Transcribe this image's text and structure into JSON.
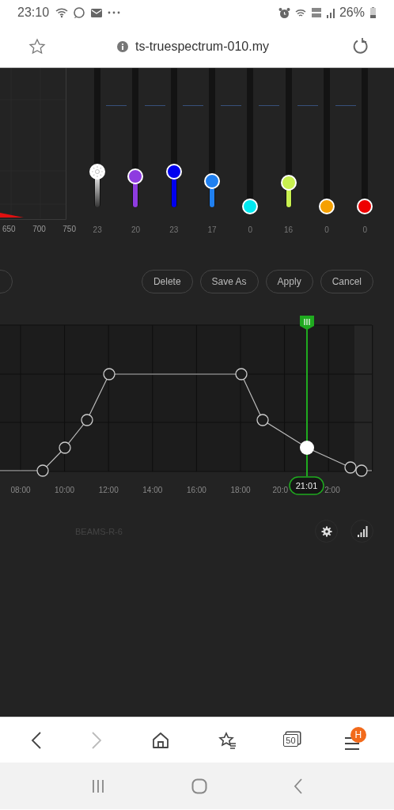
{
  "status_bar": {
    "time": "23:10",
    "battery": "26%"
  },
  "address_bar": {
    "url": "ts-truespectrum-010.my"
  },
  "spectrum": {
    "axis_labels": [
      "650",
      "700",
      "750"
    ]
  },
  "channels": [
    {
      "kind": "white",
      "color": "#ffffff",
      "level": 0.23,
      "reading": "23"
    },
    {
      "kind": "color",
      "color": "#8e3ce0",
      "level": 0.2,
      "reading": "20"
    },
    {
      "kind": "color",
      "color": "#0000ee",
      "level": 0.23,
      "reading": "23"
    },
    {
      "kind": "color",
      "color": "#2080f0",
      "level": 0.17,
      "reading": "17"
    },
    {
      "kind": "color",
      "color": "#00e8f0",
      "level": 0,
      "reading": "0"
    },
    {
      "kind": "color",
      "color": "#c8f050",
      "level": 0.16,
      "reading": "16"
    },
    {
      "kind": "color",
      "color": "#f5a000",
      "level": 0,
      "reading": "0"
    },
    {
      "kind": "color",
      "color": "#ee0000",
      "level": 0,
      "reading": "0"
    }
  ],
  "actions": [
    {
      "kind": "clipped"
    },
    {
      "kind": "button",
      "label": "Delete"
    },
    {
      "kind": "button",
      "label": "Save As"
    },
    {
      "kind": "button",
      "label": "Apply"
    },
    {
      "kind": "button",
      "label": "Cancel"
    }
  ],
  "schedule": {
    "time_labels": [
      "08:00",
      "10:00",
      "12:00",
      "14:00",
      "16:00",
      "18:00",
      "20:0",
      "2:00"
    ],
    "current_time": "21:01"
  },
  "device_name": "BEAMS-R-6",
  "browser_bar": {
    "forward_disabled": true,
    "tabs_count": "50",
    "menu_badge": "H"
  }
}
